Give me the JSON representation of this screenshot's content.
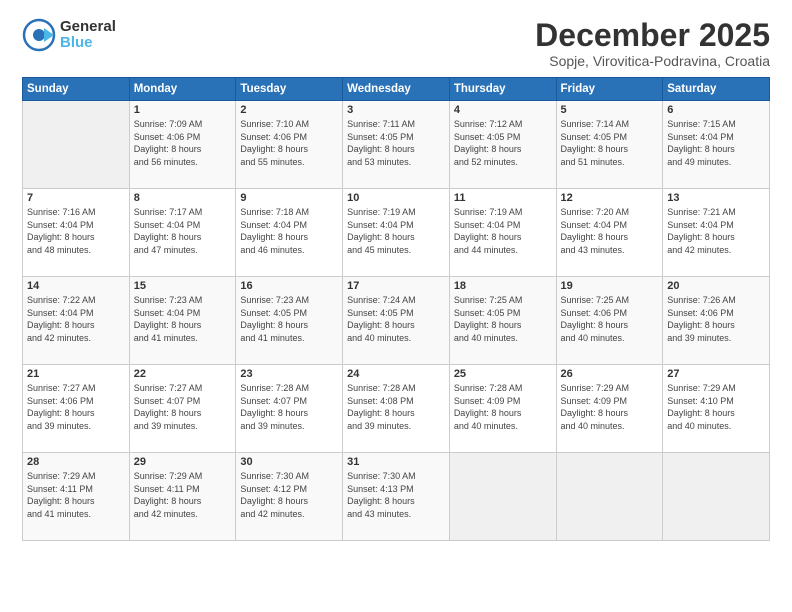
{
  "header": {
    "logo_general": "General",
    "logo_blue": "Blue",
    "month_title": "December 2025",
    "location": "Sopje, Virovitica-Podravina, Croatia"
  },
  "weekdays": [
    "Sunday",
    "Monday",
    "Tuesday",
    "Wednesday",
    "Thursday",
    "Friday",
    "Saturday"
  ],
  "weeks": [
    [
      {
        "day": "",
        "info": ""
      },
      {
        "day": "1",
        "info": "Sunrise: 7:09 AM\nSunset: 4:06 PM\nDaylight: 8 hours\nand 56 minutes."
      },
      {
        "day": "2",
        "info": "Sunrise: 7:10 AM\nSunset: 4:06 PM\nDaylight: 8 hours\nand 55 minutes."
      },
      {
        "day": "3",
        "info": "Sunrise: 7:11 AM\nSunset: 4:05 PM\nDaylight: 8 hours\nand 53 minutes."
      },
      {
        "day": "4",
        "info": "Sunrise: 7:12 AM\nSunset: 4:05 PM\nDaylight: 8 hours\nand 52 minutes."
      },
      {
        "day": "5",
        "info": "Sunrise: 7:14 AM\nSunset: 4:05 PM\nDaylight: 8 hours\nand 51 minutes."
      },
      {
        "day": "6",
        "info": "Sunrise: 7:15 AM\nSunset: 4:04 PM\nDaylight: 8 hours\nand 49 minutes."
      }
    ],
    [
      {
        "day": "7",
        "info": "Sunrise: 7:16 AM\nSunset: 4:04 PM\nDaylight: 8 hours\nand 48 minutes."
      },
      {
        "day": "8",
        "info": "Sunrise: 7:17 AM\nSunset: 4:04 PM\nDaylight: 8 hours\nand 47 minutes."
      },
      {
        "day": "9",
        "info": "Sunrise: 7:18 AM\nSunset: 4:04 PM\nDaylight: 8 hours\nand 46 minutes."
      },
      {
        "day": "10",
        "info": "Sunrise: 7:19 AM\nSunset: 4:04 PM\nDaylight: 8 hours\nand 45 minutes."
      },
      {
        "day": "11",
        "info": "Sunrise: 7:19 AM\nSunset: 4:04 PM\nDaylight: 8 hours\nand 44 minutes."
      },
      {
        "day": "12",
        "info": "Sunrise: 7:20 AM\nSunset: 4:04 PM\nDaylight: 8 hours\nand 43 minutes."
      },
      {
        "day": "13",
        "info": "Sunrise: 7:21 AM\nSunset: 4:04 PM\nDaylight: 8 hours\nand 42 minutes."
      }
    ],
    [
      {
        "day": "14",
        "info": "Sunrise: 7:22 AM\nSunset: 4:04 PM\nDaylight: 8 hours\nand 42 minutes."
      },
      {
        "day": "15",
        "info": "Sunrise: 7:23 AM\nSunset: 4:04 PM\nDaylight: 8 hours\nand 41 minutes."
      },
      {
        "day": "16",
        "info": "Sunrise: 7:23 AM\nSunset: 4:05 PM\nDaylight: 8 hours\nand 41 minutes."
      },
      {
        "day": "17",
        "info": "Sunrise: 7:24 AM\nSunset: 4:05 PM\nDaylight: 8 hours\nand 40 minutes."
      },
      {
        "day": "18",
        "info": "Sunrise: 7:25 AM\nSunset: 4:05 PM\nDaylight: 8 hours\nand 40 minutes."
      },
      {
        "day": "19",
        "info": "Sunrise: 7:25 AM\nSunset: 4:06 PM\nDaylight: 8 hours\nand 40 minutes."
      },
      {
        "day": "20",
        "info": "Sunrise: 7:26 AM\nSunset: 4:06 PM\nDaylight: 8 hours\nand 39 minutes."
      }
    ],
    [
      {
        "day": "21",
        "info": "Sunrise: 7:27 AM\nSunset: 4:06 PM\nDaylight: 8 hours\nand 39 minutes."
      },
      {
        "day": "22",
        "info": "Sunrise: 7:27 AM\nSunset: 4:07 PM\nDaylight: 8 hours\nand 39 minutes."
      },
      {
        "day": "23",
        "info": "Sunrise: 7:28 AM\nSunset: 4:07 PM\nDaylight: 8 hours\nand 39 minutes."
      },
      {
        "day": "24",
        "info": "Sunrise: 7:28 AM\nSunset: 4:08 PM\nDaylight: 8 hours\nand 39 minutes."
      },
      {
        "day": "25",
        "info": "Sunrise: 7:28 AM\nSunset: 4:09 PM\nDaylight: 8 hours\nand 40 minutes."
      },
      {
        "day": "26",
        "info": "Sunrise: 7:29 AM\nSunset: 4:09 PM\nDaylight: 8 hours\nand 40 minutes."
      },
      {
        "day": "27",
        "info": "Sunrise: 7:29 AM\nSunset: 4:10 PM\nDaylight: 8 hours\nand 40 minutes."
      }
    ],
    [
      {
        "day": "28",
        "info": "Sunrise: 7:29 AM\nSunset: 4:11 PM\nDaylight: 8 hours\nand 41 minutes."
      },
      {
        "day": "29",
        "info": "Sunrise: 7:29 AM\nSunset: 4:11 PM\nDaylight: 8 hours\nand 42 minutes."
      },
      {
        "day": "30",
        "info": "Sunrise: 7:30 AM\nSunset: 4:12 PM\nDaylight: 8 hours\nand 42 minutes."
      },
      {
        "day": "31",
        "info": "Sunrise: 7:30 AM\nSunset: 4:13 PM\nDaylight: 8 hours\nand 43 minutes."
      },
      {
        "day": "",
        "info": ""
      },
      {
        "day": "",
        "info": ""
      },
      {
        "day": "",
        "info": ""
      }
    ]
  ]
}
